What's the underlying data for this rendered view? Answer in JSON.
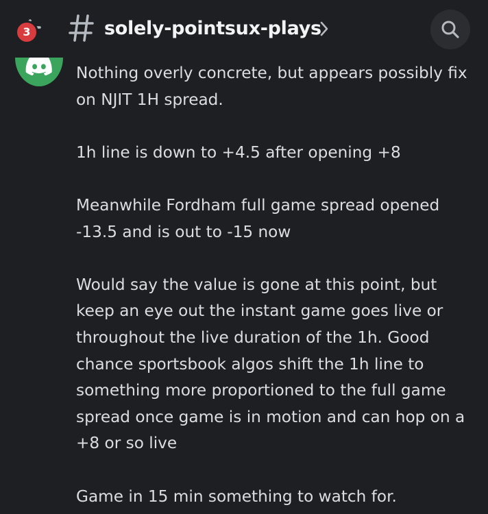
{
  "header": {
    "back_icon": "arrow-left-icon",
    "unread_badge": "3",
    "channel_icon": "hash-icon",
    "channel_name": "solely-pointsux-plays",
    "chevron_icon": "chevron-right-icon",
    "search_icon": "search-icon"
  },
  "message": {
    "avatar_icon": "discord-logo-icon",
    "avatar_color": "#3ba55d",
    "paragraphs": [
      {
        "lines": [
          "Nothing overly concrete, but appears possibly fix",
          "on NJIT 1H spread."
        ]
      },
      {
        "lines": [
          "1h line is down to +4.5 after opening +8"
        ]
      },
      {
        "lines": [
          "Meanwhile Fordham full game spread opened",
          "-13.5 and is out to -15 now"
        ]
      },
      {
        "lines": [
          "Would say the value is gone at this point, but",
          "keep an eye out the instant game goes live or",
          "throughout the live duration of the 1h. Good",
          "chance sportsbook algos shift the 1h line to",
          "something more proportioned to the full game",
          "spread once game is in motion and can hop on a",
          "+8 or so live"
        ]
      },
      {
        "lines": [
          "Game in 15 min something to watch for."
        ]
      }
    ]
  },
  "colors": {
    "background": "#1e1f22",
    "text": "#dbdee1",
    "header_text": "#f2f3f5",
    "badge": "#d83c3e",
    "icon": "#b5bac1"
  }
}
